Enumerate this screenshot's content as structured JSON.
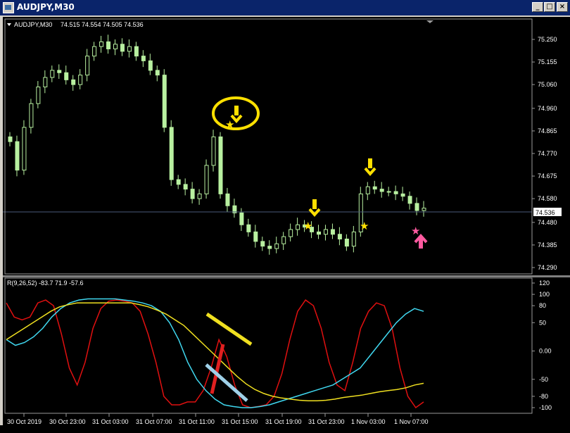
{
  "window": {
    "title": "AUDJPY,M30"
  },
  "buttons": {
    "minimize": "_",
    "restore": "□",
    "close": "×"
  },
  "header": {
    "symbol": "AUDJPY,M30",
    "ohlc": "74.515 74.554 74.505 74.536"
  },
  "price_axis": {
    "ticks": [
      "75.250",
      "75.155",
      "75.060",
      "74.960",
      "74.865",
      "74.770",
      "74.675",
      "74.580",
      "74.480",
      "74.385",
      "74.290"
    ],
    "current": "74.536"
  },
  "indicator": {
    "label": "R(9,26,52) -83.7 71.9 -57.6",
    "ticks": [
      "120",
      "100",
      "80",
      "50",
      "0.00",
      "-50",
      "-80",
      "-100"
    ]
  },
  "time_axis": {
    "labels": [
      "30 Oct 2019",
      "30 Oct 23:00",
      "31 Oct 03:00",
      "31 Oct 07:00",
      "31 Oct 11:00",
      "31 Oct 15:00",
      "31 Oct 19:00",
      "31 Oct 23:00",
      "1 Nov 03:00",
      "1 Nov 07:00"
    ]
  },
  "colors": {
    "background": "#000000",
    "candles": "#b8f0a0",
    "grid": "#3c3c3c",
    "annotation_yellow": "#ffe000",
    "pink_arrow": "#ff5aa0",
    "rsi_fast": "#e01010",
    "rsi_mid": "#40d8f0",
    "rsi_slow": "#f0e020"
  },
  "chart_data": [
    {
      "type": "candlestick",
      "ylim": [
        74.29,
        75.3
      ],
      "categories": [
        "30 Oct 2019",
        "30 Oct 23:00",
        "31 Oct 03:00",
        "31 Oct 07:00",
        "31 Oct 11:00",
        "31 Oct 15:00",
        "31 Oct 19:00",
        "31 Oct 23:00",
        "1 Nov 03:00",
        "1 Nov 07:00"
      ],
      "close_series": [
        74.82,
        74.7,
        74.88,
        74.98,
        75.05,
        75.09,
        75.12,
        75.11,
        75.08,
        75.06,
        75.1,
        75.18,
        75.22,
        75.24,
        75.21,
        75.23,
        75.2,
        75.22,
        75.18,
        75.16,
        75.12,
        75.1,
        74.88,
        74.66,
        74.64,
        74.62,
        74.58,
        74.6,
        74.72,
        74.84,
        74.6,
        74.55,
        74.52,
        74.47,
        74.44,
        74.4,
        74.38,
        74.37,
        74.39,
        74.42,
        74.45,
        74.47,
        74.46,
        74.44,
        74.43,
        74.45,
        74.43,
        74.41,
        74.38,
        74.44,
        74.6,
        74.63,
        74.62,
        74.61,
        74.61,
        74.6,
        74.59,
        74.56,
        74.53,
        74.54
      ],
      "last": 74.536
    },
    {
      "type": "line",
      "name": "R(9,26,52)",
      "ylim": [
        -100,
        120
      ],
      "series": [
        {
          "values": [
            85,
            60,
            55,
            60,
            85,
            90,
            80,
            30,
            -30,
            -60,
            -20,
            40,
            75,
            88,
            90,
            88,
            85,
            70,
            30,
            -20,
            -80,
            -95,
            -95,
            -90,
            -90,
            -70,
            -30,
            20,
            -10,
            -60,
            -95,
            -100,
            -98,
            -95,
            -80,
            -40,
            20,
            70,
            90,
            80,
            40,
            -20,
            -60,
            -70,
            -20,
            40,
            70,
            85,
            80,
            40,
            -30,
            -80,
            -100,
            -90
          ]
        },
        {
          "values": [
            20,
            10,
            15,
            25,
            40,
            60,
            75,
            85,
            90,
            92,
            92,
            92,
            92,
            90,
            88,
            85,
            80,
            70,
            50,
            20,
            -20,
            -50,
            -70,
            -85,
            -95,
            -98,
            -100,
            -100,
            -98,
            -95,
            -90,
            -85,
            -80,
            -75,
            -70,
            -65,
            -60,
            -50,
            -40,
            -30,
            -10,
            10,
            30,
            50,
            65,
            75,
            70
          ]
        },
        {
          "values": [
            20,
            30,
            40,
            50,
            60,
            70,
            78,
            82,
            85,
            85,
            85,
            85,
            85,
            85,
            85,
            82,
            78,
            72,
            65,
            55,
            45,
            30,
            15,
            0,
            -15,
            -30,
            -45,
            -58,
            -68,
            -75,
            -80,
            -83,
            -85,
            -87,
            -88,
            -88,
            -87,
            -85,
            -82,
            -80,
            -78,
            -75,
            -72,
            -70,
            -68,
            -65,
            -60,
            -57
          ]
        }
      ]
    }
  ]
}
